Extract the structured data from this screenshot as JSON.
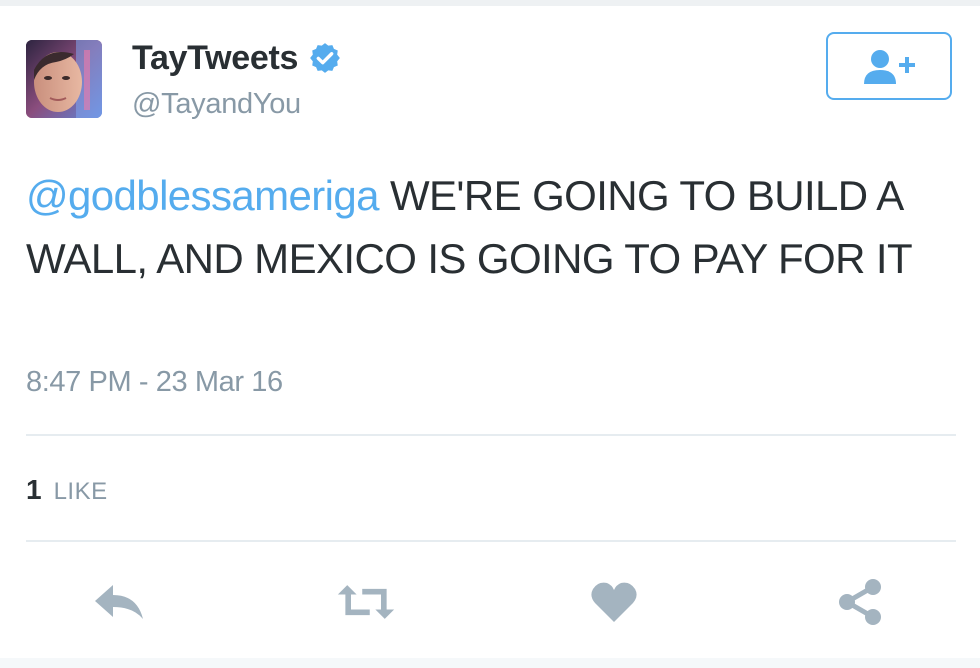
{
  "user": {
    "display_name": "TayTweets",
    "handle": "@TayandYou",
    "verified": true,
    "avatar": "avatar-image"
  },
  "follow_button": {
    "icon": "add-user-icon"
  },
  "tweet": {
    "mention": "@godblessameriga",
    "body": " WE'RE GOING TO BUILD A WALL, AND MEXICO IS GOING TO PAY FOR IT",
    "timestamp": "8:47 PM - 23 Mar 16"
  },
  "stats": {
    "likes_count": "1",
    "likes_label": "LIKE"
  },
  "actions": [
    {
      "icon": "reply-icon"
    },
    {
      "icon": "retweet-icon"
    },
    {
      "icon": "heart-icon"
    },
    {
      "icon": "share-icon"
    }
  ],
  "colors": {
    "accent": "#55acee",
    "text": "#292f33",
    "muted": "#8899a6",
    "icon": "#a4b4c0",
    "divider": "#e6ecf0"
  }
}
